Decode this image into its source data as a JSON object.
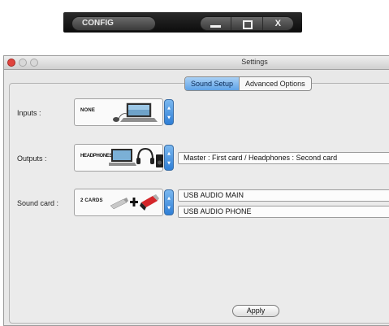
{
  "toolbar": {
    "config_label": "CONFIG",
    "minimize_label": "",
    "maximize_label": "",
    "close_label": "X"
  },
  "window": {
    "title": "Settings"
  },
  "tabs": [
    {
      "label": "Sound Setup",
      "active": true
    },
    {
      "label": "Advanced Options",
      "active": false
    }
  ],
  "inputs": {
    "label": "Inputs :",
    "selection": "NONE"
  },
  "outputs": {
    "label": "Outputs :",
    "selection": "HEADPHONES",
    "field_value": "Master : First card / Headphones : Second card"
  },
  "sound_card": {
    "label": "Sound card :",
    "selection": "2 CARDS",
    "main_value": "USB AUDIO MAIN",
    "phone_value": "USB AUDIO PHONE"
  },
  "apply_label": "Apply",
  "colors": {
    "accent": "#5fa3e8",
    "close_red": "#e0443e",
    "toolbar_bg": "#1a1a1a"
  },
  "icons": {
    "inputs": [
      "laptop-icon",
      "mouse-icon"
    ],
    "outputs": [
      "laptop-icon",
      "headphones-icon",
      "speaker-icon"
    ],
    "sound_card": [
      "usb-stick-icon",
      "plus-icon",
      "usb-audio-card-icon"
    ]
  }
}
